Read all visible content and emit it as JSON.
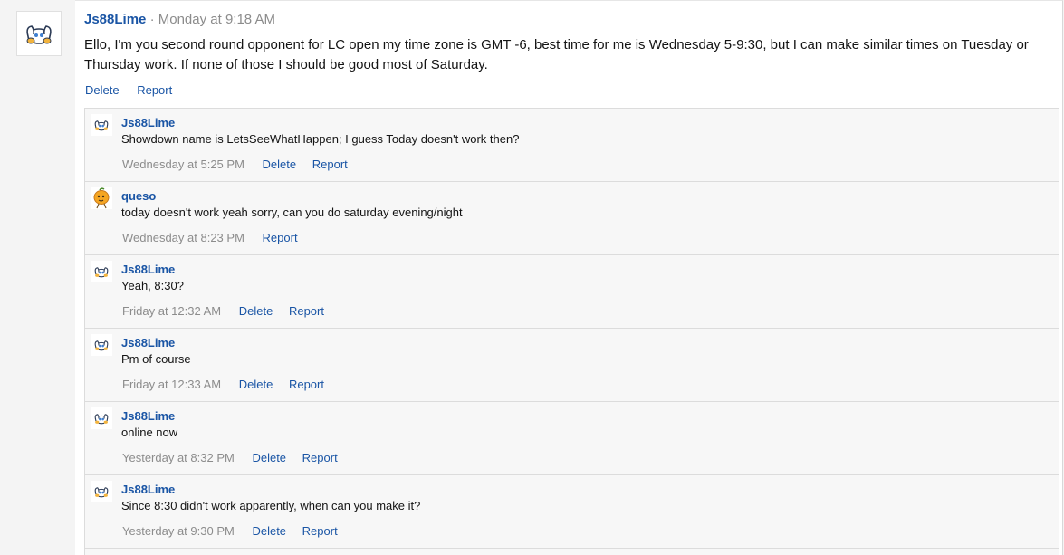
{
  "post": {
    "username": "Js88Lime",
    "separator": "·",
    "time": "Monday at 9:18 AM",
    "body": "Ello, I'm you second round opponent for LC open my time zone is GMT -6, best time for me is Wednesday 5-9:30, but I can make similar times on Tuesday or Thursday work. If none of those I should be good most of Saturday.",
    "actions": {
      "delete": "Delete",
      "report": "Report"
    },
    "avatar_icon": "cartoon-creature-avatar-icon"
  },
  "comments": [
    {
      "username": "Js88Lime",
      "text": "Showdown name is LetsSeeWhatHappen; I guess Today doesn't work then?",
      "time": "Wednesday at 5:25 PM",
      "delete": "Delete",
      "report": "Report",
      "avatar_icon": "cartoon-creature-avatar-icon"
    },
    {
      "username": "queso",
      "text": "today doesn't work yeah sorry, can you do saturday evening/night",
      "time": "Wednesday at 8:23 PM",
      "delete": null,
      "report": "Report",
      "avatar_icon": "orange-creature-avatar-icon"
    },
    {
      "username": "Js88Lime",
      "text": "Yeah, 8:30?",
      "time": "Friday at 12:32 AM",
      "delete": "Delete",
      "report": "Report",
      "avatar_icon": "cartoon-creature-avatar-icon"
    },
    {
      "username": "Js88Lime",
      "text": "Pm of course",
      "time": "Friday at 12:33 AM",
      "delete": "Delete",
      "report": "Report",
      "avatar_icon": "cartoon-creature-avatar-icon"
    },
    {
      "username": "Js88Lime",
      "text": "online now",
      "time": "Yesterday at 8:32 PM",
      "delete": "Delete",
      "report": "Report",
      "avatar_icon": "cartoon-creature-avatar-icon"
    },
    {
      "username": "Js88Lime",
      "text": "Since 8:30 didn't work apparently, when can you make it?",
      "time": "Yesterday at 9:30 PM",
      "delete": "Delete",
      "report": "Report",
      "avatar_icon": "cartoon-creature-avatar-icon"
    }
  ],
  "colors": {
    "link": "#1a55a5",
    "muted": "#8c8c8c",
    "text": "#141414",
    "comment_bg": "#f7f7f7"
  }
}
